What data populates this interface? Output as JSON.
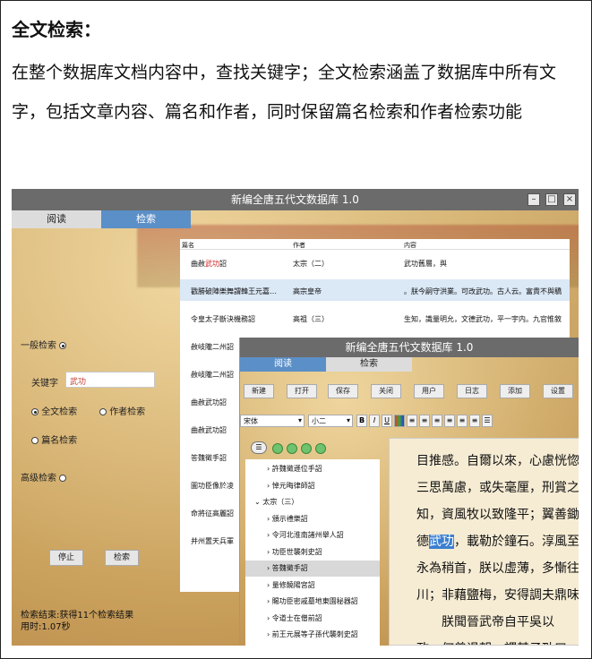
{
  "heading": "全文检索：",
  "paragraph": "在整个数据库文档内容中，查找关键字；全文检索涵盖了数据库中所有文字，包括文章内容、篇名和作者，同时保留篇名检索和作者检索功能",
  "main_window": {
    "title": "新编全唐五代文数据库 1.0",
    "tabs": [
      "阅读",
      "检索"
    ],
    "search_panel": {
      "general_search_label": "一般检索",
      "keyword_label": "关键字",
      "keyword_value": "武功",
      "fulltext_label": "全文检索",
      "author_label": "作者检索",
      "title_search_label": "篇名检索",
      "advanced_label": "高级检索",
      "stop_button": "停止",
      "search_button": "检索",
      "status_line1": "检索结束:获得11个检索结果",
      "status_line2": "用时:1.07秒"
    },
    "results": {
      "headers": [
        "篇名",
        "作者",
        "内容"
      ],
      "rows": [
        {
          "title_pre": "曲赦",
          "title_hl": "武功",
          "title_post": "詔",
          "author": "太宗（二）",
          "content": "武功舊層，與"
        },
        {
          "title_pre": "戳勝破陣樂舞謂韓王元嘉…",
          "title_hl": "",
          "title_post": "",
          "author": "高宗皇帝",
          "content": "。朕今嗣守洪業。可改武功。古人云。富貴不與驕"
        },
        {
          "title_pre": "令皇太子斷決機務詔",
          "title_hl": "",
          "title_post": "",
          "author": "高祖（三）",
          "content": "生知，識量明允，文德武功，平一宇内。九官惟敘"
        },
        {
          "title_pre": "赦岐隴二州詔",
          "title_hl": "",
          "title_post": "",
          "author": "太宗（二）",
          "content": "惟。行經咸陽，始至武功三縣，見築之以，碕曬"
        },
        {
          "title_pre": "赦岐隴二州詔",
          "title_hl": "",
          "title_post": "",
          "author": "",
          "content": ""
        },
        {
          "title_pre": "曲赦武功詔",
          "title_hl": "",
          "title_post": "",
          "author": "",
          "content": ""
        },
        {
          "title_pre": "曲赦武功詔",
          "title_hl": "",
          "title_post": "",
          "author": "",
          "content": ""
        },
        {
          "title_pre": "答魏徵手詔",
          "title_hl": "",
          "title_post": "",
          "author": "",
          "content": ""
        },
        {
          "title_pre": "圖功臣像於凌",
          "title_hl": "",
          "title_post": "",
          "author": "",
          "content": ""
        },
        {
          "title_pre": "命將征高麗詔",
          "title_hl": "",
          "title_post": "",
          "author": "",
          "content": ""
        },
        {
          "title_pre": "并州置天兵軍",
          "title_hl": "",
          "title_post": "",
          "author": "",
          "content": ""
        }
      ]
    }
  },
  "second_window": {
    "title": "新编全唐五代文数据库 1.0",
    "tabs": [
      "阅读",
      "检索"
    ],
    "toolbar": [
      "新建",
      "打开",
      "保存",
      "关闭",
      "用户",
      "日志",
      "添加",
      "设置"
    ],
    "font_name": "宋体",
    "font_size": "小二",
    "tree": [
      {
        "indent": 1,
        "text": "許魏徵遜位手詔"
      },
      {
        "indent": 1,
        "text": "悼元晦律師詔"
      },
      {
        "indent": 0,
        "text": "太宗（三）"
      },
      {
        "indent": 1,
        "text": "頒示禮樂詔"
      },
      {
        "indent": 1,
        "text": "令河北淮南諸州舉人詔"
      },
      {
        "indent": 1,
        "text": "功臣世襲刺史詔"
      },
      {
        "indent": 1,
        "text": "答魏徵手詔"
      },
      {
        "indent": 1,
        "text": "量修饒陽宮詔"
      },
      {
        "indent": 1,
        "text": "賜功臣密戚墓地東園秘器詔"
      },
      {
        "indent": 1,
        "text": "令道士在僧前詔"
      },
      {
        "indent": 1,
        "text": "前王元展等子孫代襲刺史詔"
      }
    ],
    "doc_lines": [
      {
        "pre": "目推感。自爾以來，心慮恍惚",
        "hl": "",
        "post": ""
      },
      {
        "pre": "三思萬慮，或失毫厘，刑賞之",
        "hl": "",
        "post": ""
      },
      {
        "pre": "知，資風牧以致隆平；翼善鋤",
        "hl": "",
        "post": ""
      },
      {
        "pre": "德",
        "hl": "武功",
        "post": "，載勒於鐘石。淳風至"
      },
      {
        "pre": "永為稍首，朕以虛薄，多慚往",
        "hl": "",
        "post": ""
      },
      {
        "pre": "川；非藉鹽梅，安得調夫鼎味",
        "hl": "",
        "post": ""
      },
      {
        "pre": "　　朕聞晉武帝自平吳以",
        "hl": "",
        "post": ""
      },
      {
        "pre": "政。何曾退朝，謂其子劭曰：",
        "hl": "",
        "post": ""
      }
    ]
  },
  "colors": {
    "title_bar": "#6b6b6b",
    "active_tab": "#5b8fc7",
    "highlight": "#d02020",
    "selection": "#3b7fd1"
  }
}
